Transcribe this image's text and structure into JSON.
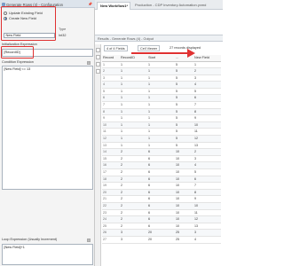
{
  "config_panel": {
    "title": "Generate Rows (4) - Configuration",
    "pin_icon": "pin-icon",
    "options": [
      {
        "label": "Update Existing Field",
        "selected": false
      },
      {
        "label": "Create New Field",
        "selected": true
      }
    ],
    "column_type_header": "Type",
    "field_name": "New Field",
    "field_type": "Int32",
    "initialization_label": "Initialization Expression",
    "initialization_value": "[RecordID]",
    "condition_label": "Condition Expression",
    "condition_value": "[New Field] <= 13",
    "loop_label": "Loop Expression (Usually Increment)",
    "loop_value": "[New Field]+1"
  },
  "tabs": [
    {
      "label": "New Workflow1*",
      "active": true
    },
    {
      "label": "Production - CDP Inventory Automation.yxmd",
      "active": false
    }
  ],
  "results": {
    "title": "Results - Generate Rows (4) - Output",
    "fields_dropdown": "4 of 4 Fields",
    "view_dropdown": "Cell Viewer",
    "records_displayed": "27 records displayed",
    "columns": [
      "Record",
      "RecordID",
      "Start",
      "...",
      "New Field"
    ],
    "rows": [
      [
        "1",
        "1",
        "1",
        "5",
        "1"
      ],
      [
        "2",
        "1",
        "1",
        "5",
        "2"
      ],
      [
        "3",
        "1",
        "1",
        "5",
        "3"
      ],
      [
        "4",
        "1",
        "1",
        "5",
        "4"
      ],
      [
        "5",
        "1",
        "1",
        "5",
        "5"
      ],
      [
        "6",
        "1",
        "1",
        "5",
        "6"
      ],
      [
        "7",
        "1",
        "1",
        "5",
        "7"
      ],
      [
        "8",
        "1",
        "1",
        "5",
        "8"
      ],
      [
        "9",
        "1",
        "1",
        "5",
        "9"
      ],
      [
        "10",
        "1",
        "1",
        "5",
        "10"
      ],
      [
        "11",
        "1",
        "1",
        "5",
        "11"
      ],
      [
        "12",
        "1",
        "1",
        "5",
        "12"
      ],
      [
        "13",
        "1",
        "1",
        "5",
        "13"
      ],
      [
        "14",
        "2",
        "6",
        "10",
        "2"
      ],
      [
        "15",
        "2",
        "6",
        "10",
        "3"
      ],
      [
        "16",
        "2",
        "6",
        "10",
        "4"
      ],
      [
        "17",
        "2",
        "6",
        "10",
        "5"
      ],
      [
        "18",
        "2",
        "6",
        "10",
        "6"
      ],
      [
        "19",
        "2",
        "6",
        "10",
        "7"
      ],
      [
        "20",
        "2",
        "6",
        "10",
        "8"
      ],
      [
        "21",
        "2",
        "6",
        "10",
        "9"
      ],
      [
        "22",
        "2",
        "6",
        "10",
        "10"
      ],
      [
        "23",
        "2",
        "6",
        "10",
        "11"
      ],
      [
        "24",
        "2",
        "6",
        "10",
        "12"
      ],
      [
        "25",
        "2",
        "6",
        "10",
        "13"
      ],
      [
        "26",
        "3",
        "20",
        "25",
        "3"
      ],
      [
        "27",
        "3",
        "20",
        "25",
        "4"
      ]
    ]
  },
  "annotation": {
    "box_color": "#e03131",
    "arrow_color": "#e03131"
  },
  "toolbar_icons": [
    "table-icon",
    "filter-icon",
    "sort-icon",
    "settings-icon"
  ]
}
